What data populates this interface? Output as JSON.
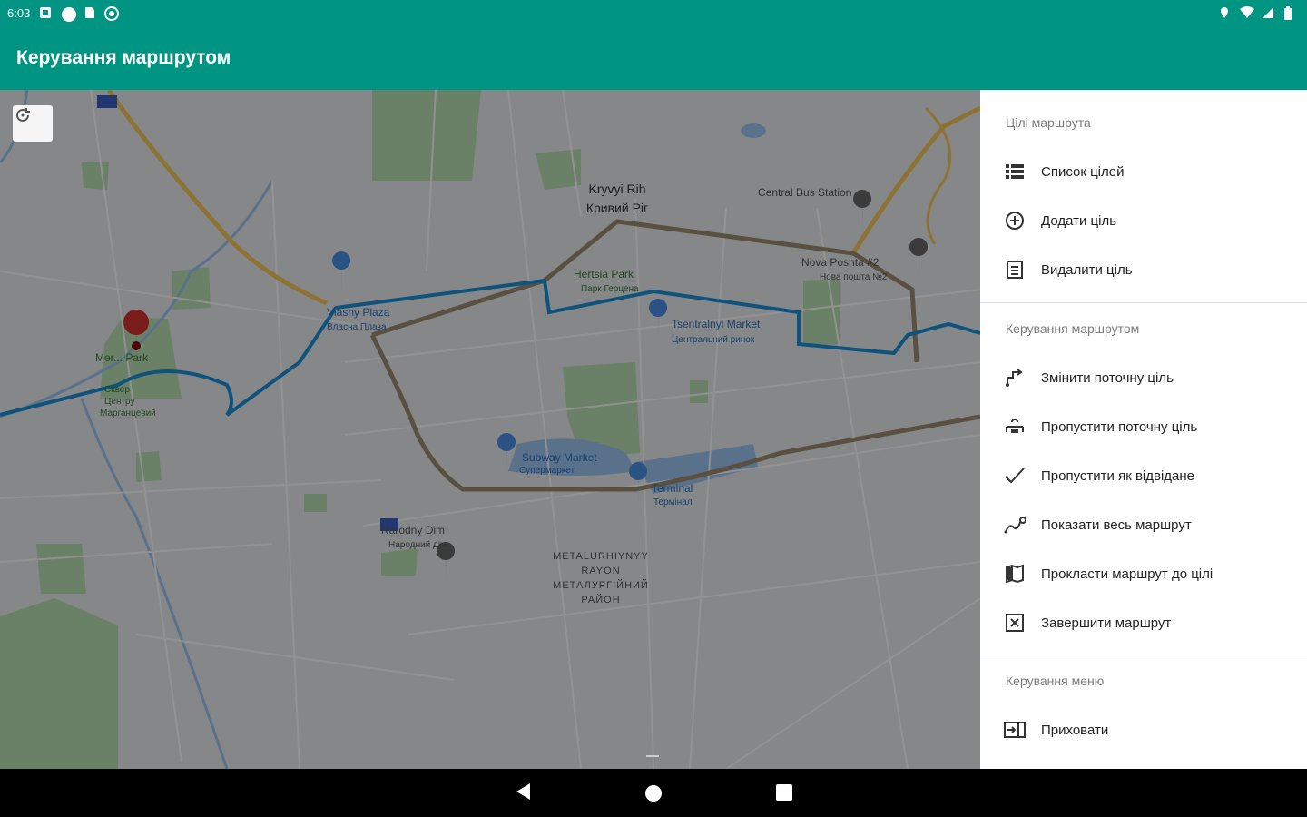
{
  "status": {
    "time": "6:03"
  },
  "appbar": {
    "title": "Керування маршрутом"
  },
  "map": {
    "labels": {
      "city_en": "Kryvyi Rih",
      "city_uk": "Кривий Ріг",
      "bus_station": "Central Bus Station",
      "nova_poshta_en": "Nova Poshta #2",
      "nova_poshta_uk": "Нова пошта №2",
      "hertsia_park_en": "Hertsia Park",
      "hertsia_park_uk": "Парк Герцена",
      "vlasny_plaza_en": "Vlasny Plaza",
      "vlasny_plaza_uk": "Власна Плаза",
      "market_en": "Tsentralnyi Market",
      "market_uk": "Центральний ринок",
      "mer_park": "Mer... Park",
      "subway_en": "Subway Market",
      "subway_uk": "Супермаркет",
      "terminal_en": "Terminal",
      "terminal_uk": "Термінал",
      "narodny_en": "Narodny Dim",
      "narodny_uk": "Народний дім",
      "district_1": "METALURHIYNYY",
      "district_2": "RAYON",
      "district_3": "МЕТАЛУРГІЙНИЙ",
      "district_4": "РАЙОН",
      "west_park_1": "Сквер",
      "west_park_2": "Центру",
      "west_park_3": "Марганцевий"
    }
  },
  "drawer": {
    "sections": [
      {
        "header": "Цілі маршрута",
        "items": [
          {
            "label": "Список цілей",
            "icon": "list-icon"
          },
          {
            "label": "Додати ціль",
            "icon": "add-circle-icon"
          },
          {
            "label": "Видалити ціль",
            "icon": "delete-document-icon"
          }
        ]
      },
      {
        "header": "Керування маршрутом",
        "items": [
          {
            "label": "Змінити поточну ціль",
            "icon": "change-target-icon"
          },
          {
            "label": "Пропустити поточну ціль",
            "icon": "skip-target-icon"
          },
          {
            "label": "Пропустити як відвідане",
            "icon": "check-icon"
          },
          {
            "label": "Показати весь маршрут",
            "icon": "route-icon"
          },
          {
            "label": "Прокласти маршрут до цілі",
            "icon": "map-icon"
          },
          {
            "label": "Завершити маршрут",
            "icon": "close-box-icon"
          }
        ]
      },
      {
        "header": "Керування меню",
        "items": [
          {
            "label": "Приховати",
            "icon": "hide-icon"
          }
        ]
      }
    ]
  },
  "colors": {
    "primary": "#009582",
    "route": "#1a8fd6",
    "marker": "#d0312d"
  }
}
